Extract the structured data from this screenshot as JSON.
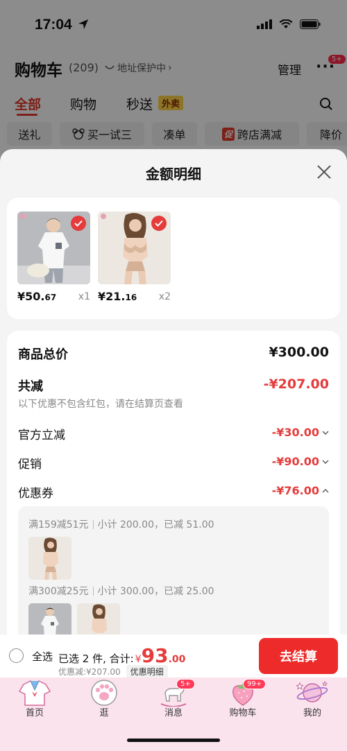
{
  "status_bar": {
    "time": "17:04"
  },
  "header": {
    "title": "购物车",
    "count": "(209)",
    "address_protect": "地址保护中",
    "manage": "管理",
    "more_badge": "5+"
  },
  "tabs": [
    {
      "label": "全部"
    },
    {
      "label": "购物"
    },
    {
      "label": "秒送"
    }
  ],
  "tab_badge": "外卖",
  "filters": [
    "送礼",
    "买一试三",
    "凑单",
    "跨店满减",
    "降价"
  ],
  "promo_tag": "促",
  "sheet": {
    "title": "金额明细",
    "products": [
      {
        "price_int": "¥50.",
        "price_dec": "67",
        "qty": "x1"
      },
      {
        "price_int": "¥21.",
        "price_dec": "16",
        "qty": "x2"
      }
    ],
    "summary": {
      "total_label": "商品总价",
      "total_value": "¥300.00",
      "reduce_label": "共减",
      "reduce_value": "-¥207.00",
      "note": "以下优惠不包含红包，请在结算页查看",
      "official_label": "官方立减",
      "official_value": "-¥30.00",
      "promo_label": "促销",
      "promo_value": "-¥90.00",
      "coupon_label": "优惠券",
      "coupon_value": "-¥76.00"
    },
    "coupons": [
      {
        "rule": "满159减51元",
        "detail": "小计 200.00，已减 51.00"
      },
      {
        "rule": "满300减25元",
        "detail": "小计 300.00，已减 25.00"
      }
    ]
  },
  "checkout": {
    "select_all": "全选",
    "selected_text": "已选 2 件, 合计:",
    "currency": "¥",
    "total_int": "93",
    "total_dec": ".00",
    "discount_text": "优惠减:¥207.00",
    "detail_link": "优惠明细",
    "button": "去结算"
  },
  "tab_bar": {
    "items": [
      {
        "label": "首页"
      },
      {
        "label": "逛"
      },
      {
        "label": "消息"
      },
      {
        "label": "购物车"
      },
      {
        "label": "我的"
      }
    ],
    "message_badge": "5+",
    "cart_badge": "99+"
  },
  "colors": {
    "accent_red": "#e53b3b",
    "checkout_red": "#ee2b2b",
    "tab_bar_pink": "#fbe3ee"
  }
}
